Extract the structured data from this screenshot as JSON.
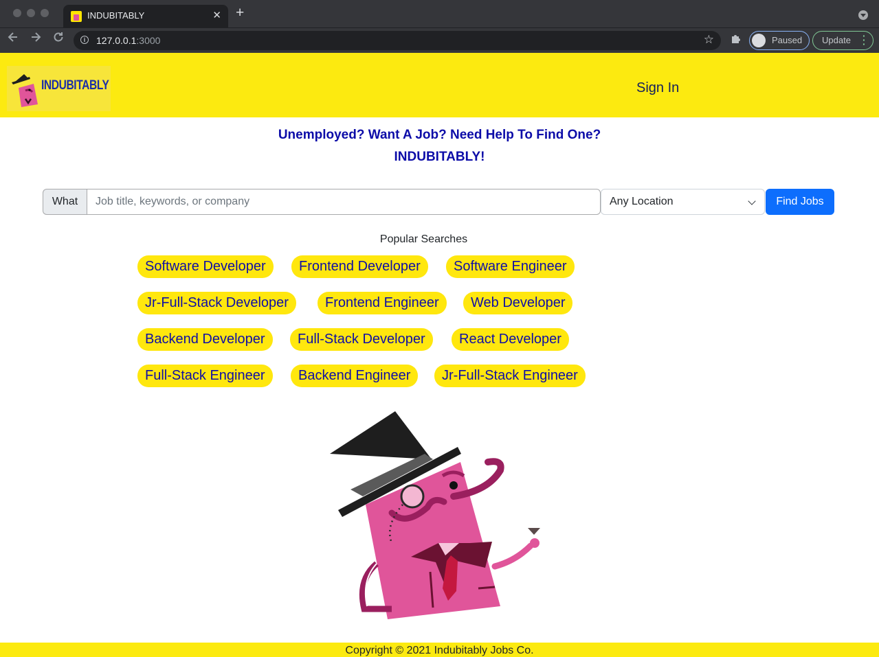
{
  "browser": {
    "tab_title": "INDUBITABLY",
    "tab_close": "✕",
    "new_tab": "+",
    "url_host": "127.0.0.1",
    "url_port": ":3000",
    "profile_status": "Paused",
    "update_label": "Update"
  },
  "header": {
    "logo_text": "INDUBITABLY",
    "sign_in": "Sign In"
  },
  "hero": {
    "line1": "Unemployed? Want A Job? Need Help To Find One?",
    "line2": "INDUBITABLY!"
  },
  "search": {
    "what_label": "What",
    "placeholder": "Job title, keywords, or company",
    "location": "Any Location",
    "button": "Find Jobs"
  },
  "popular": {
    "title": "Popular Searches",
    "chips": [
      "Software Developer",
      "Frontend Developer",
      "Software Engineer",
      "Jr-Full-Stack Developer",
      "Frontend Engineer",
      "Web Developer",
      "Backend Developer",
      "Full-Stack Developer",
      "React Developer",
      "Full-Stack Engineer",
      "Backend Engineer",
      "Jr-Full-Stack Engineer"
    ]
  },
  "footer": {
    "copyright": "Copyright © 2021 Indubitably Jobs Co."
  },
  "colors": {
    "brand_yellow": "#fcea10",
    "chip_yellow": "#ffe70e",
    "brand_blue": "#0c0ca8",
    "button_blue": "#0d6efd",
    "mascot_pink": "#e0559a"
  }
}
